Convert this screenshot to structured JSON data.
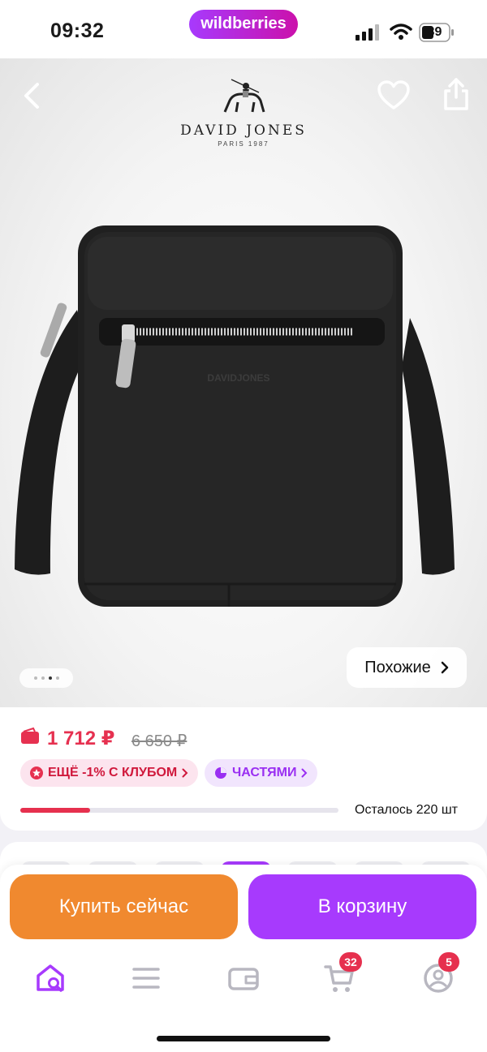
{
  "status_bar": {
    "time": "09:32",
    "brand_pill": "wildberries",
    "battery": "39"
  },
  "product": {
    "brand_name": "DAVID JONES",
    "brand_sub": "PARIS 1987",
    "bag_logo": "DAVIDJONES",
    "carousel": {
      "total": 4,
      "active_index": 2
    },
    "similar_label": "Похожие"
  },
  "price": {
    "current": "1 712 ₽",
    "old": "6 650 ₽",
    "club_chip": "ЕЩЁ -1% С КЛУБОМ",
    "parts_chip": "ЧАСТЯМИ",
    "stock_text": "Осталось 220 шт",
    "stock_fraction": 0.22
  },
  "actions": {
    "buy_now": "Купить сейчас",
    "add_to_cart": "В корзину"
  },
  "tabbar": {
    "items": [
      {
        "icon": "home-search-icon",
        "active": true
      },
      {
        "icon": "catalog-menu-icon"
      },
      {
        "icon": "wallet-icon"
      },
      {
        "icon": "cart-icon",
        "badge": "32"
      },
      {
        "icon": "profile-icon",
        "badge": "5"
      }
    ]
  },
  "colors": {
    "accent": "#a73afd",
    "buy_now": "#f0892f",
    "price": "#e63150",
    "badge": "#e6304e"
  }
}
